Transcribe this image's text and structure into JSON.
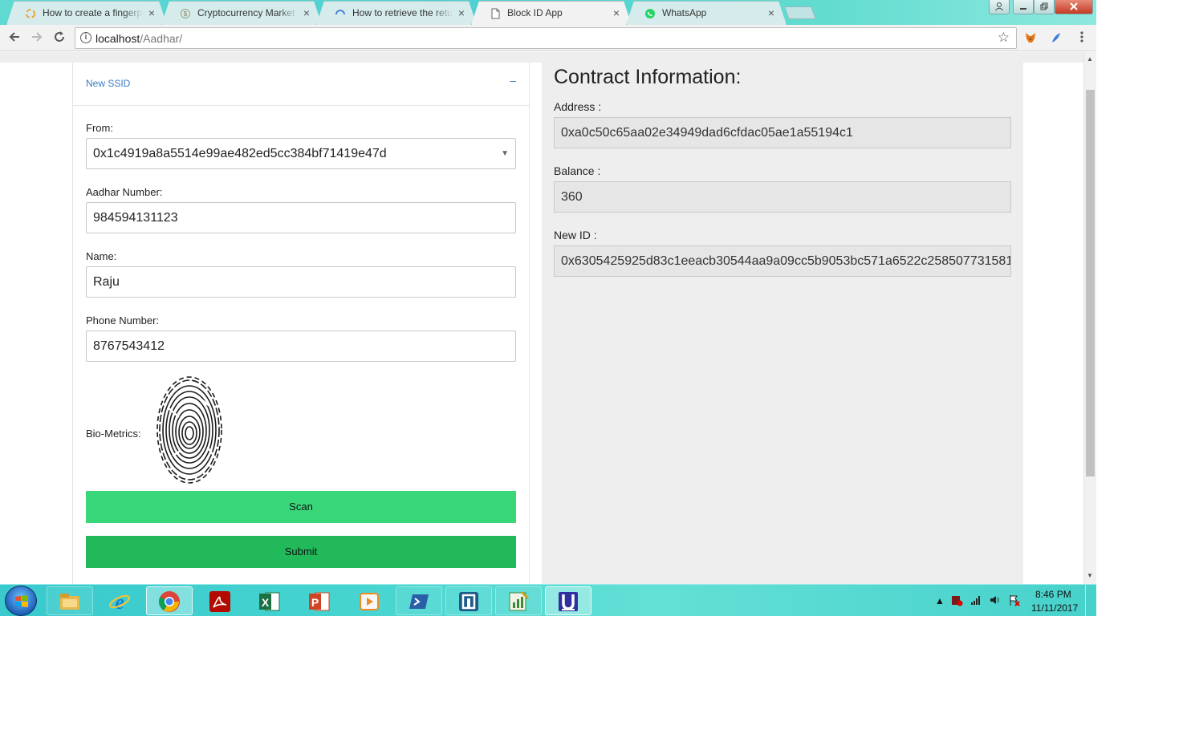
{
  "browser": {
    "tabs": [
      {
        "title": "How to create a fingerpr",
        "icon": "loading-spinner-icon"
      },
      {
        "title": "Cryptocurrency Market C",
        "icon": "coin-icon"
      },
      {
        "title": "How to retrieve the retur",
        "icon": "loading-ring-icon"
      },
      {
        "title": "Block ID App",
        "icon": "page-icon",
        "active": true
      },
      {
        "title": "WhatsApp",
        "icon": "whatsapp-icon"
      }
    ],
    "tab_close_glyph": "×",
    "url_host": "localhost",
    "url_path": "/Aadhar/"
  },
  "form": {
    "section_title": "New SSID",
    "toggle_glyph": "–",
    "from_label": "From:",
    "from_value": "0x1c4919a8a5514e99ae482ed5cc384bf71419e47d",
    "aadhar_label": "Aadhar Number:",
    "aadhar_value": "984594131123",
    "name_label": "Name:",
    "name_value": "Raju",
    "phone_label": "Phone Number:",
    "phone_value": "8767543412",
    "bio_label": "Bio-Metrics:",
    "scan_label": "Scan",
    "submit_label": "Submit"
  },
  "contract": {
    "title": "Contract Information:",
    "address_label": "Address :",
    "address_value": "0xa0c50c65aa02e34949dad6cfdac05ae1a55194c1",
    "balance_label": "Balance :",
    "balance_value": "360",
    "newid_label": "New ID :",
    "newid_value": "0x6305425925d83c1eeacb30544aa9a09cc5b9053bc571a6522c258507731581"
  },
  "taskbar": {
    "apps": [
      {
        "name": "file-explorer-icon",
        "color": "#e8b84a"
      },
      {
        "name": "internet-explorer-icon",
        "color": "#1c7fd6"
      },
      {
        "name": "chrome-icon",
        "color": "#db4437",
        "active": true
      },
      {
        "name": "acrobat-icon",
        "color": "#b30b00"
      },
      {
        "name": "excel-icon",
        "color": "#1d7044"
      },
      {
        "name": "powerpoint-icon",
        "color": "#d04423"
      },
      {
        "name": "media-player-icon",
        "color": "#f08a24"
      },
      {
        "name": "powershell-icon",
        "color": "#2a5fa8"
      },
      {
        "name": "bracket-app-icon",
        "color": "#1d5a8a"
      },
      {
        "name": "chart-editor-icon",
        "color": "#3a8a3a"
      },
      {
        "name": "u-app-icon",
        "color": "#2f2fa0"
      }
    ],
    "time": "8:46 PM",
    "date": "11/11/2017"
  }
}
